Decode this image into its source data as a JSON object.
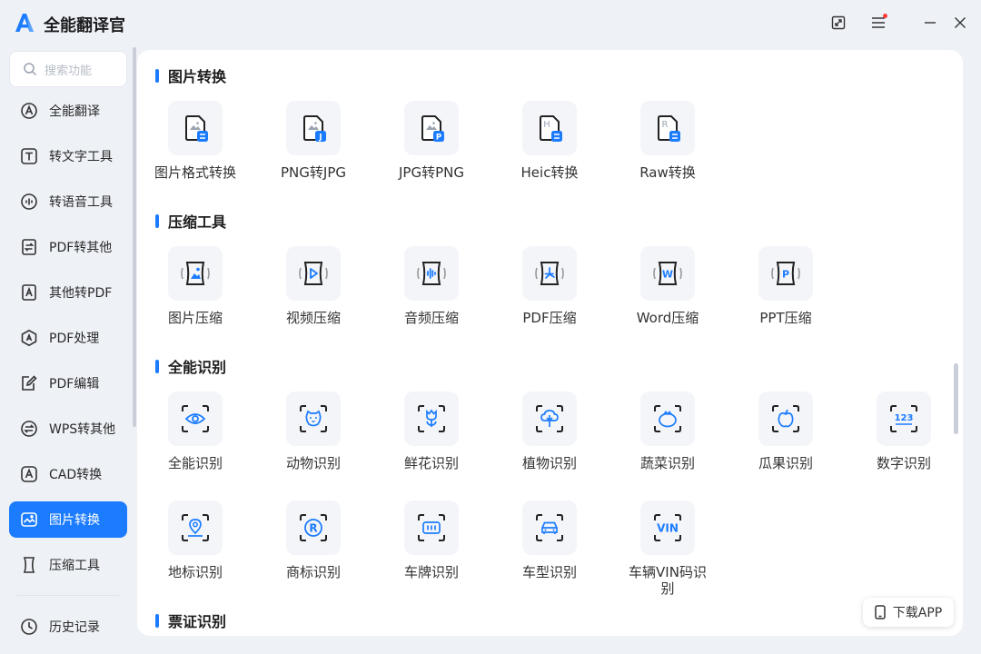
{
  "app": {
    "title": "全能翻译官"
  },
  "search": {
    "placeholder": "搜索功能"
  },
  "sidebar": {
    "items": [
      {
        "label": "全能翻译",
        "icon": "translate-icon"
      },
      {
        "label": "转文字工具",
        "icon": "text-tool-icon"
      },
      {
        "label": "转语音工具",
        "icon": "voice-tool-icon"
      },
      {
        "label": "PDF转其他",
        "icon": "pdf-convert-icon"
      },
      {
        "label": "其他转PDF",
        "icon": "to-pdf-icon"
      },
      {
        "label": "PDF处理",
        "icon": "pdf-process-icon"
      },
      {
        "label": "PDF编辑",
        "icon": "pdf-edit-icon"
      },
      {
        "label": "WPS转其他",
        "icon": "wps-convert-icon"
      },
      {
        "label": "CAD转换",
        "icon": "cad-icon"
      },
      {
        "label": "图片转换",
        "icon": "image-convert-icon",
        "active": true
      },
      {
        "label": "压缩工具",
        "icon": "compress-icon"
      }
    ],
    "history": "历史记录"
  },
  "sections": [
    {
      "title": "图片转换",
      "tools": [
        {
          "label": "图片格式转换",
          "icon": "image-format-icon"
        },
        {
          "label": "PNG转JPG",
          "icon": "png-to-jpg-icon"
        },
        {
          "label": "JPG转PNG",
          "icon": "jpg-to-png-icon"
        },
        {
          "label": "Heic转换",
          "icon": "heic-icon"
        },
        {
          "label": "Raw转换",
          "icon": "raw-icon"
        }
      ]
    },
    {
      "title": "压缩工具",
      "tools": [
        {
          "label": "图片压缩",
          "icon": "image-compress-icon"
        },
        {
          "label": "视频压缩",
          "icon": "video-compress-icon"
        },
        {
          "label": "音频压缩",
          "icon": "audio-compress-icon"
        },
        {
          "label": "PDF压缩",
          "icon": "pdf-compress-icon"
        },
        {
          "label": "Word压缩",
          "icon": "word-compress-icon"
        },
        {
          "label": "PPT压缩",
          "icon": "ppt-compress-icon"
        }
      ]
    },
    {
      "title": "全能识别",
      "tools": [
        {
          "label": "全能识别",
          "icon": "eye-scan-icon"
        },
        {
          "label": "动物识别",
          "icon": "animal-scan-icon"
        },
        {
          "label": "鲜花识别",
          "icon": "flower-scan-icon"
        },
        {
          "label": "植物识别",
          "icon": "plant-scan-icon"
        },
        {
          "label": "蔬菜识别",
          "icon": "vegetable-scan-icon"
        },
        {
          "label": "瓜果识别",
          "icon": "fruit-scan-icon"
        },
        {
          "label": "数字识别",
          "icon": "number-scan-icon",
          "glyph": "123"
        },
        {
          "label": "地标识别",
          "icon": "landmark-scan-icon"
        },
        {
          "label": "商标识别",
          "icon": "trademark-scan-icon",
          "glyph": "R"
        },
        {
          "label": "车牌识别",
          "icon": "plate-scan-icon"
        },
        {
          "label": "车型识别",
          "icon": "car-scan-icon"
        },
        {
          "label": "车辆VIN码识别",
          "icon": "vin-scan-icon",
          "glyph": "VIN"
        }
      ]
    },
    {
      "title": "票证识别",
      "tools": []
    }
  ],
  "download": {
    "label": "下载APP"
  },
  "colors": {
    "accent": "#1c7cff",
    "background": "#eef1f6",
    "tile": "#f3f5f9"
  }
}
